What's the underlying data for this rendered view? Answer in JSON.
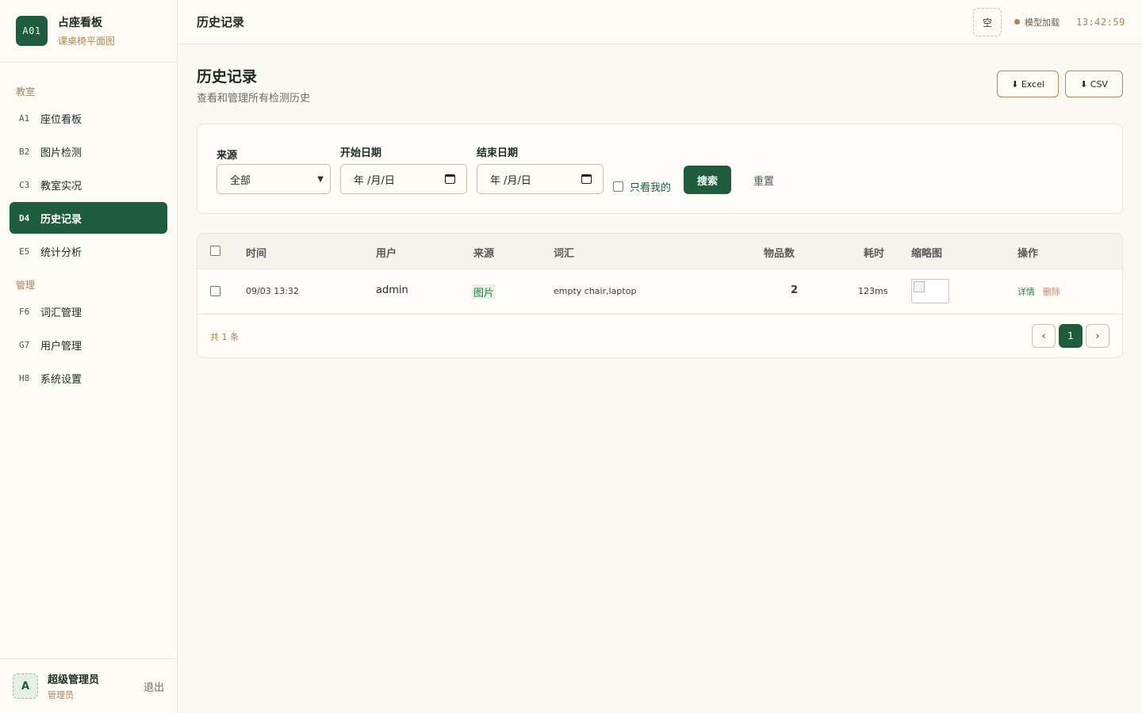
{
  "brand": {
    "logo": "A01",
    "title": "占座看板",
    "subtitle": "课桌椅平面图"
  },
  "nav": {
    "groups": [
      "教室",
      "管理"
    ],
    "items": [
      {
        "code": "A1",
        "label": "座位看板"
      },
      {
        "code": "B2",
        "label": "图片检测"
      },
      {
        "code": "C3",
        "label": "教室实况"
      },
      {
        "code": "D4",
        "label": "历史记录",
        "active": true
      },
      {
        "code": "E5",
        "label": "统计分析"
      },
      {
        "code": "F6",
        "label": "词汇管理"
      },
      {
        "code": "G7",
        "label": "用户管理"
      },
      {
        "code": "H8",
        "label": "系统设置"
      }
    ]
  },
  "user": {
    "avatar": "A",
    "name": "超级管理员",
    "role": "管理员",
    "logout": "退出"
  },
  "topbar": {
    "title": "历史记录",
    "empty_label": "空",
    "model_status": "模型加载",
    "time": "13:42:59"
  },
  "page": {
    "title": "历史记录",
    "subtitle": "查看和管理所有检测历史",
    "export_excel": "⬇ Excel",
    "export_csv": "⬇ CSV"
  },
  "filters": {
    "source_label": "来源",
    "source_value": "全部",
    "start_label": "开始日期",
    "start_placeholder": "年 /月/日",
    "end_label": "结束日期",
    "end_placeholder": "年 /月/日",
    "mine_label": "只看我的",
    "search": "搜索",
    "reset": "重置"
  },
  "table": {
    "headers": [
      "时间",
      "用户",
      "来源",
      "词汇",
      "物品数",
      "耗时",
      "缩略图",
      "操作"
    ],
    "rows": [
      {
        "time": "09/03 13:32",
        "user": "admin",
        "source": "图片",
        "vocab": "empty chair,laptop",
        "count": "2",
        "duration": "123ms",
        "detail": "详情",
        "delete": "删除"
      }
    ],
    "total": "共 1 条",
    "pagination": {
      "prev": "‹",
      "current": "1",
      "next": "›"
    }
  },
  "colors": {
    "primary": "#1f5c3d",
    "accent": "#a5835b",
    "danger": "#d97a6c"
  }
}
